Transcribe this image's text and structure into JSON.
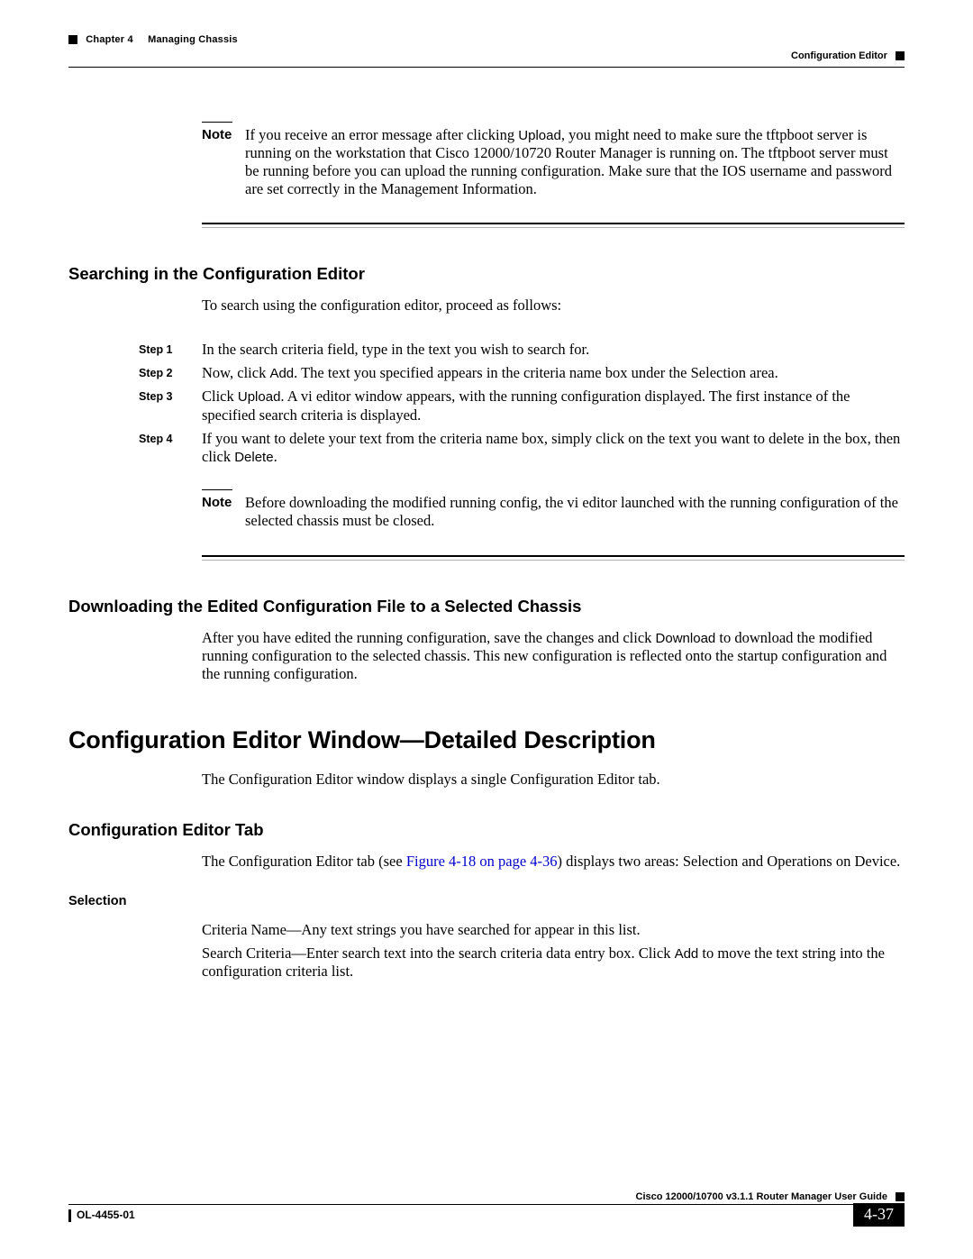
{
  "header": {
    "chapter_label": "Chapter 4",
    "chapter_title": "Managing Chassis",
    "section_title": "Configuration Editor"
  },
  "note1": {
    "label": "Note",
    "text_pre": "If you receive an error message after clicking ",
    "upload": "Upload",
    "text_post": ", you might need to make sure the tftpboot server is running on the workstation that Cisco 12000/10720 Router Manager is running on. The tftpboot server must be running before you can upload the running configuration. Make sure that the IOS username and password are set correctly in the Management Information."
  },
  "section_search": {
    "title": "Searching in the Configuration Editor",
    "intro": "To search using the configuration editor, proceed as follows:"
  },
  "steps": [
    {
      "label": "Step 1",
      "text": "In the search criteria field, type in the text you wish to search for."
    },
    {
      "label": "Step 2",
      "pre": "Now, click ",
      "btn": "Add",
      "post": ". The text you specified appears in the criteria name box under the Selection area."
    },
    {
      "label": "Step 3",
      "pre": "Click ",
      "btn": "Upload",
      "post": ". A vi editor window appears, with the running configuration displayed. The first instance of the specified search criteria is displayed."
    },
    {
      "label": "Step 4",
      "pre": "If you want to delete your text from the criteria name box, simply click on the text you want to delete in the box, then click ",
      "btn": "Delete",
      "post": "."
    }
  ],
  "note2": {
    "label": "Note",
    "text": "Before downloading the modified running config, the vi editor launched with the running configuration of the selected chassis must be closed."
  },
  "section_download": {
    "title": "Downloading the Edited Configuration File to a Selected Chassis",
    "pre": "After you have edited the running configuration, save the changes and click ",
    "btn": "Download",
    "post": " to download the modified running configuration to the selected chassis. This new configuration is reflected onto the startup configuration and the running configuration."
  },
  "h1": "Configuration Editor Window—Detailed Description",
  "h1_intro": "The Configuration Editor window displays a single Configuration Editor tab.",
  "section_tab": {
    "title": "Configuration Editor Tab",
    "pre": "The Configuration Editor tab (see ",
    "link": "Figure 4-18 on page 4-36",
    "post": ") displays two areas: Selection and Operations on Device."
  },
  "selection": {
    "title": "Selection",
    "p1": "Criteria Name—Any text strings you have searched for appear in this list.",
    "p2_pre": "Search Criteria—Enter search text into the search criteria data entry box. Click ",
    "p2_btn": "Add",
    "p2_post": " to move the text string into the configuration criteria list."
  },
  "footer": {
    "guide": "Cisco 12000/10700 v3.1.1 Router Manager User Guide",
    "doc_id": "OL-4455-01",
    "page": "4-37"
  }
}
